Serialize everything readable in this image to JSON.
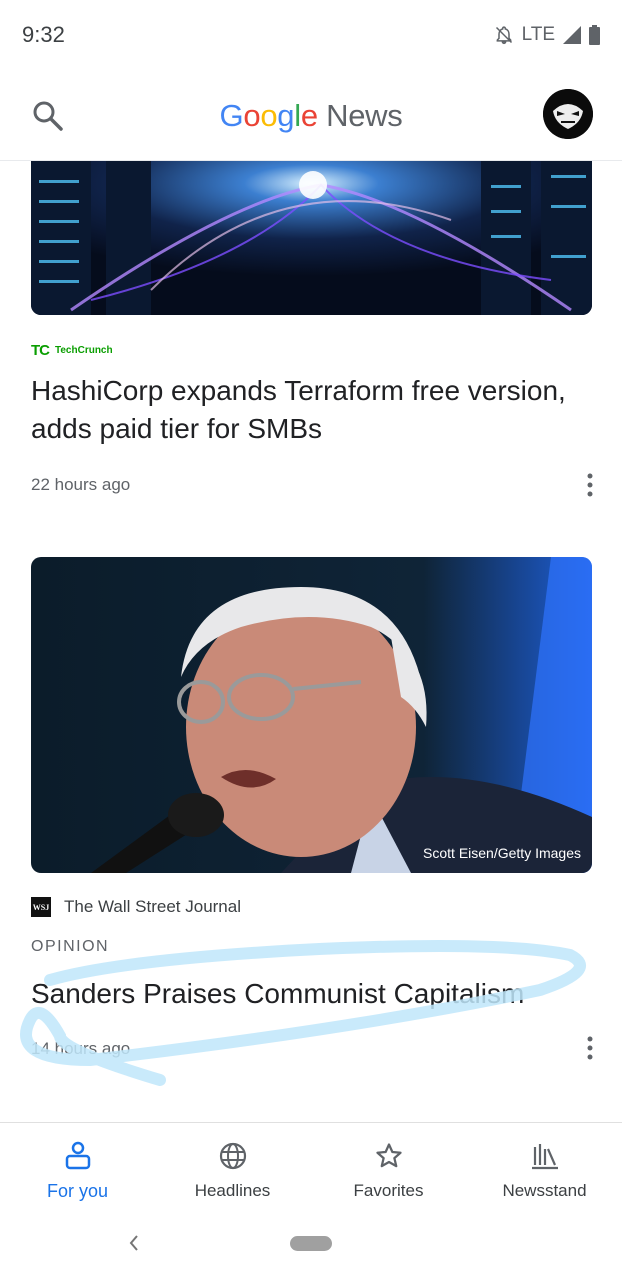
{
  "status_bar": {
    "time": "9:32",
    "network": "LTE",
    "icons": [
      "bell-off-icon",
      "signal-icon",
      "battery-icon"
    ]
  },
  "header": {
    "logo": {
      "g1": "G",
      "g2": "o",
      "g3": "o",
      "g4": "g",
      "g5": "l",
      "g6": "e",
      "news": "News"
    },
    "search_icon": "search-icon",
    "avatar": "profile-avatar"
  },
  "colors": {
    "accent": "#1a73e8",
    "text": "#202124",
    "secondary": "#5f6368",
    "techcrunch": "#0a9e01",
    "scribble": "#bfe6fa"
  },
  "stories": [
    {
      "source_logo": "TC",
      "source": "TechCrunch",
      "title": "HashiCorp expands Terraform free version, adds paid tier for SMBs",
      "time": "22 hours ago"
    },
    {
      "image_credit": "Scott Eisen/Getty Images",
      "source_logo": "WSJ",
      "source": "The Wall Street Journal",
      "label": "OPINION",
      "title": "Sanders Praises Communist Capitalism",
      "time": "14 hours ago"
    }
  ],
  "bottom_nav": [
    {
      "label": "For you",
      "icon": "for-you-icon",
      "active": true
    },
    {
      "label": "Headlines",
      "icon": "globe-icon",
      "active": false
    },
    {
      "label": "Favorites",
      "icon": "star-icon",
      "active": false
    },
    {
      "label": "Newsstand",
      "icon": "newsstand-icon",
      "active": false
    }
  ]
}
